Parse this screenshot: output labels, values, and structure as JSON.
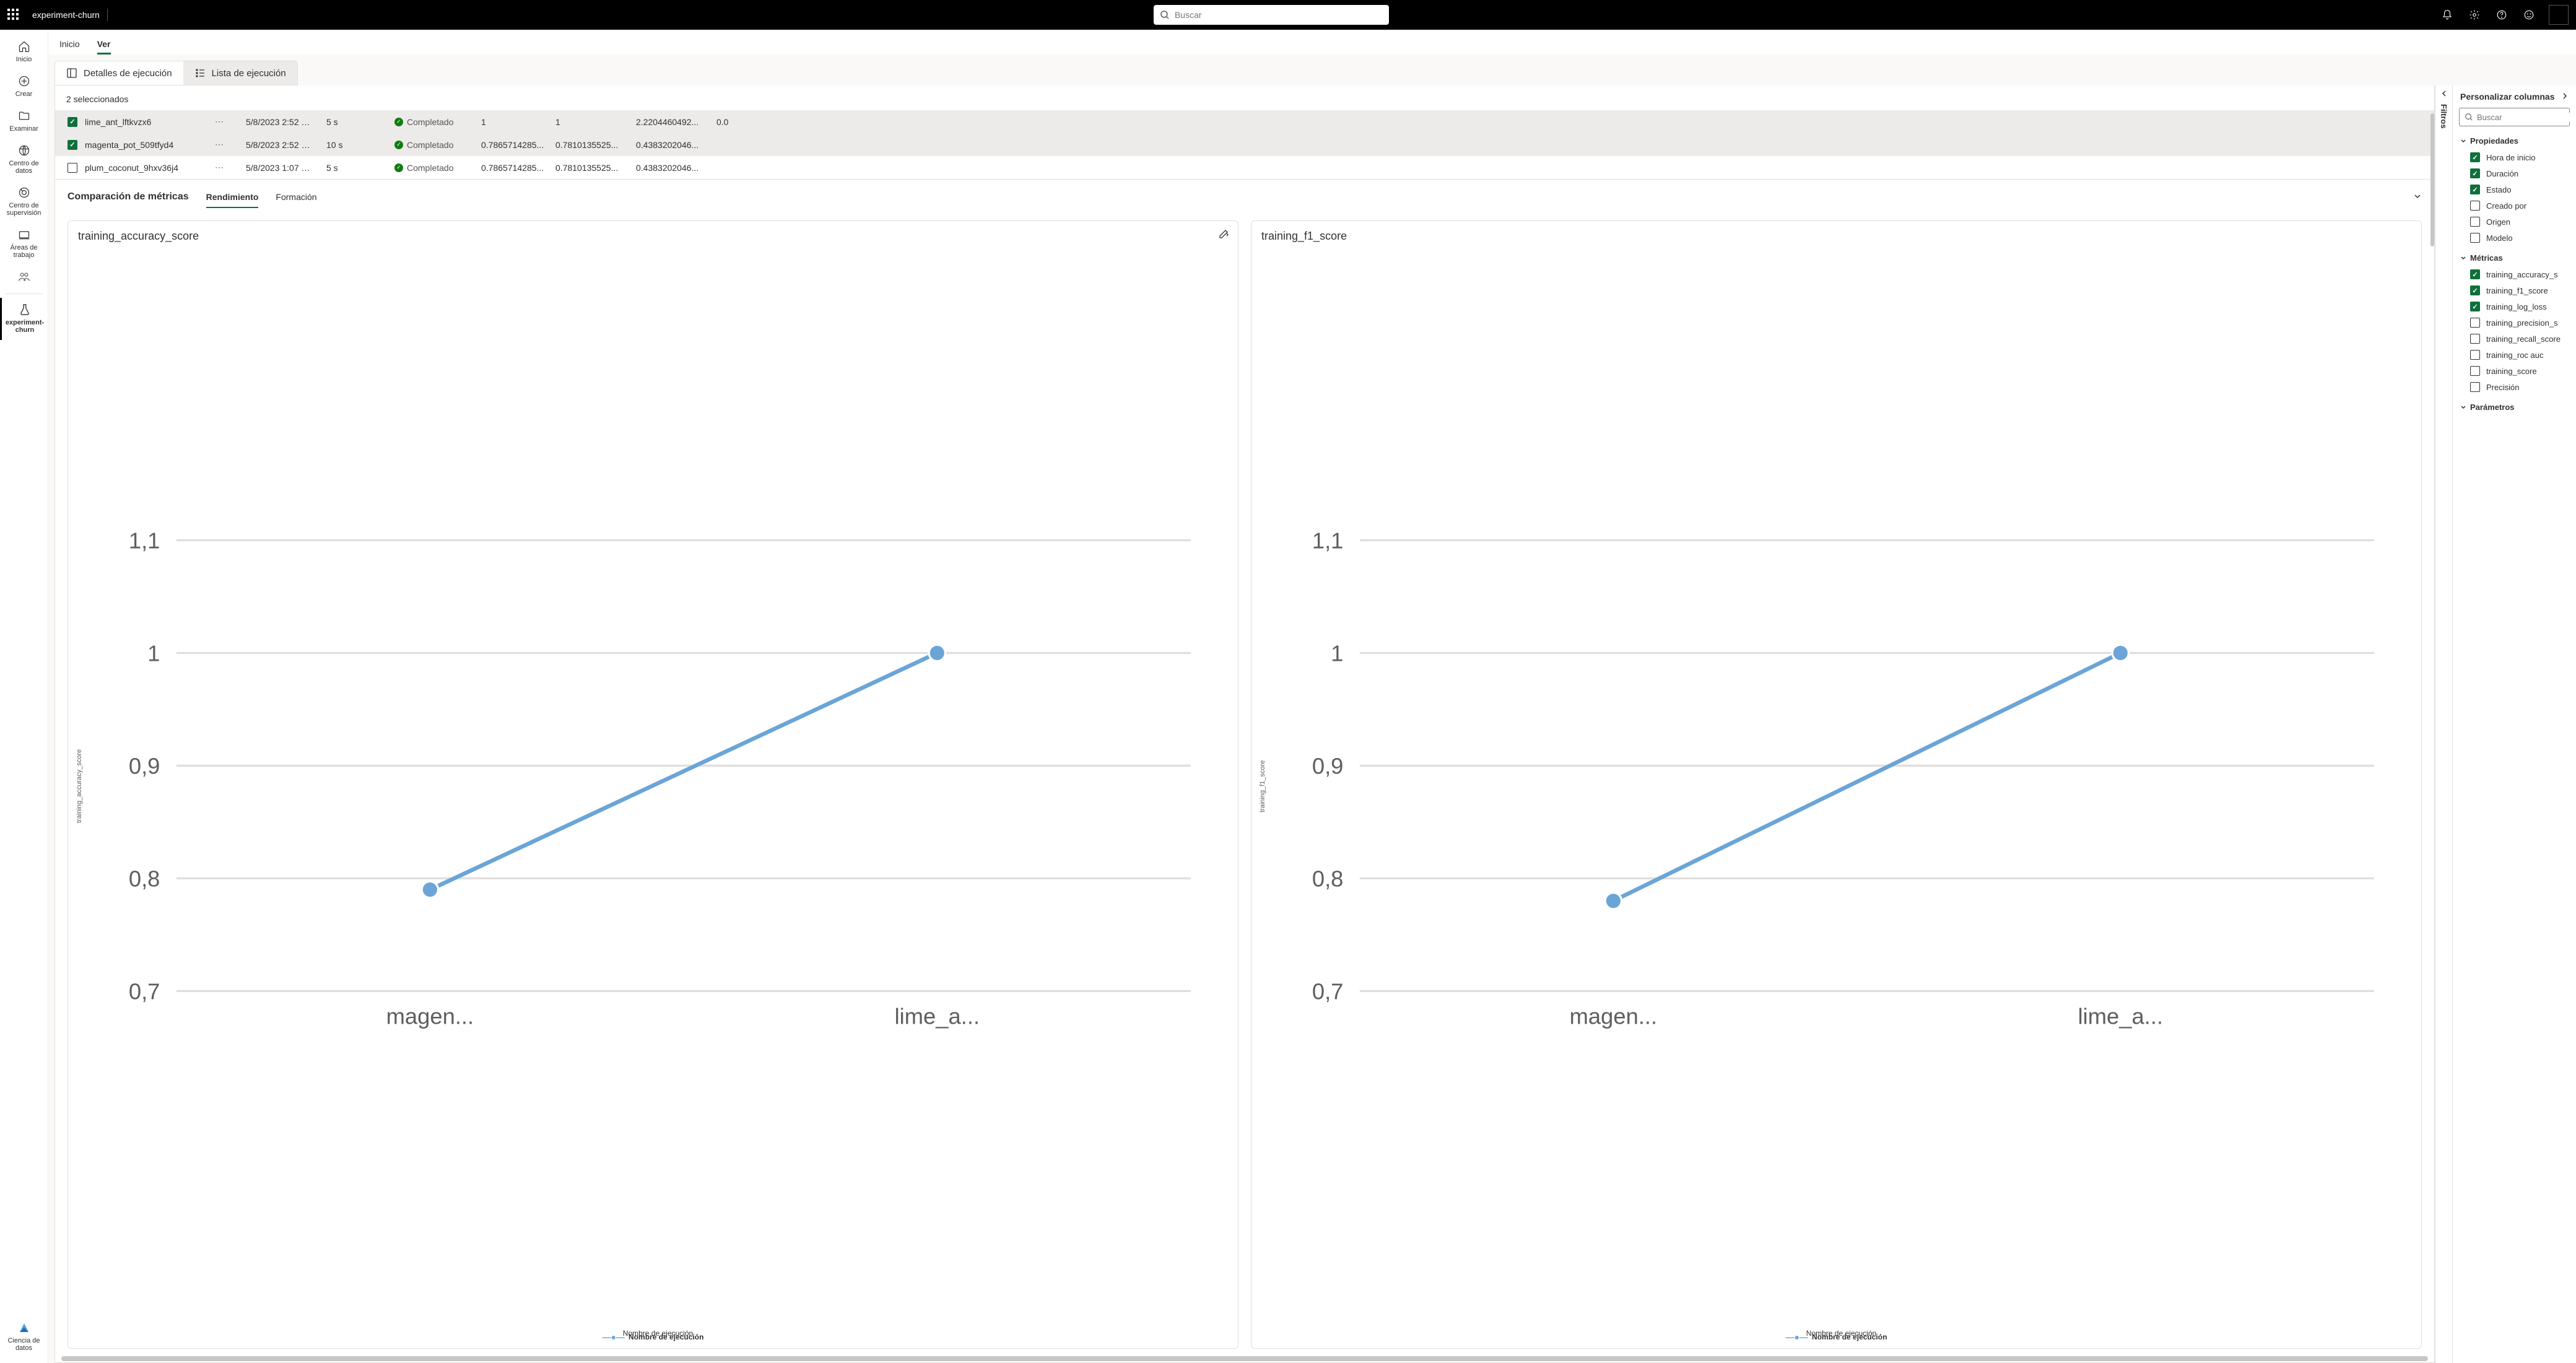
{
  "header": {
    "app_title": "experiment-churn",
    "search_placeholder": "Buscar"
  },
  "left_rail": {
    "items": [
      {
        "label": "Inicio"
      },
      {
        "label": "Crear"
      },
      {
        "label": "Examinar"
      },
      {
        "label": "Centro de datos"
      },
      {
        "label": "Centro de supervisión"
      },
      {
        "label": "Áreas de trabajo"
      },
      {
        "label": ""
      }
    ],
    "active_label": "experiment-churn",
    "bottom_label": "Ciencia de datos"
  },
  "page_tabs": {
    "home": "Inicio",
    "view": "Ver"
  },
  "subtabs": {
    "details": "Detalles de ejecución",
    "list": "Lista de ejecución"
  },
  "selection_count": "2 seleccionados",
  "table": {
    "rows": [
      {
        "checked": true,
        "name": "lime_ant_lftkvzx6",
        "ts": "5/8/2023 2:52 …",
        "dur": "5 s",
        "status": "Completado",
        "c1": "1",
        "c2": "1",
        "c3": "2.2204460492...",
        "c4": "0.0"
      },
      {
        "checked": true,
        "name": "magenta_pot_509tfyd4",
        "ts": "5/8/2023 2:52 …",
        "dur": "10 s",
        "status": "Completado",
        "c1": "0.7865714285...",
        "c2": "0.7810135525...",
        "c3": "0.4383202046...",
        "c4": ""
      },
      {
        "checked": false,
        "name": "plum_coconut_9hxv36j4",
        "ts": "5/8/2023 1:07 …",
        "dur": "5 s",
        "status": "Completado",
        "c1": "0.7865714285...",
        "c2": "0.7810135525...",
        "c3": "0.4383202046...",
        "c4": ""
      }
    ]
  },
  "metrics": {
    "title": "Comparación de métricas",
    "tab_perf": "Rendimiento",
    "tab_train": "Formación"
  },
  "charts_meta": {
    "xlabel": "Nombre de ejecución",
    "legend": "Nombre de ejecución",
    "chart1_title": "training_accuracy_score",
    "chart2_title": "training_f1_score",
    "x_cat1": "magen...",
    "x_cat2": "lime_a..."
  },
  "chart_data": [
    {
      "type": "line",
      "title": "training_accuracy_score",
      "xlabel": "Nombre de ejecución",
      "ylabel": "training_accuracy_score",
      "categories": [
        "magenta_pot_509tfyd4",
        "lime_ant_lftkvzx6"
      ],
      "values": [
        0.79,
        1.0
      ],
      "ylim": [
        0.7,
        1.1
      ],
      "legend": "Nombre de ejecución"
    },
    {
      "type": "line",
      "title": "training_f1_score",
      "xlabel": "Nombre de ejecución",
      "ylabel": "training_f1_score",
      "categories": [
        "magenta_pot_509tfyd4",
        "lime_ant_lftkvzx6"
      ],
      "values": [
        0.78,
        1.0
      ],
      "ylim": [
        0.7,
        1.1
      ],
      "legend": "Nombre de ejecución"
    }
  ],
  "filters_label": "Filtros",
  "right_panel": {
    "title": "Personalizar columnas",
    "search_placeholder": "Buscar",
    "groups": [
      {
        "name": "Propiedades",
        "items": [
          {
            "label": "Hora de inicio",
            "checked": true
          },
          {
            "label": "Duración",
            "checked": true
          },
          {
            "label": "Estado",
            "checked": true
          },
          {
            "label": "Creado por",
            "checked": false
          },
          {
            "label": "Origen",
            "checked": false
          },
          {
            "label": "Modelo",
            "checked": false
          }
        ]
      },
      {
        "name": "Métricas",
        "items": [
          {
            "label": "training_accuracy_s",
            "checked": true
          },
          {
            "label": "training_f1_score",
            "checked": true
          },
          {
            "label": "training_log_loss",
            "checked": true
          },
          {
            "label": "training_precision_s",
            "checked": false
          },
          {
            "label": "training_recall_score",
            "checked": false
          },
          {
            "label": "training_roc auc",
            "checked": false
          },
          {
            "label": "training_score",
            "checked": false
          },
          {
            "label": "Precisión",
            "checked": false
          }
        ]
      },
      {
        "name": "Parámetros",
        "items": []
      }
    ]
  },
  "yticks": [
    "1,1",
    "1",
    "0,9",
    "0,8",
    "0,7"
  ]
}
